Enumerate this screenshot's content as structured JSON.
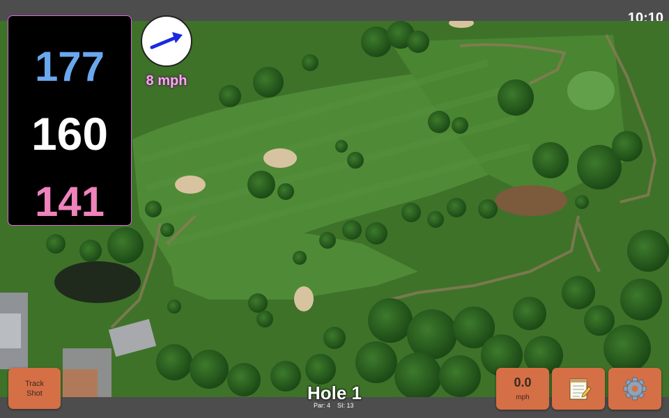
{
  "status": {
    "clock": "10:10"
  },
  "yardages": {
    "back": "177",
    "middle": "160",
    "front": "141"
  },
  "wind": {
    "speed": "8 mph",
    "icon": "wind-arrow-icon",
    "arrow_color": "#1a2adf"
  },
  "buttons": {
    "track_shot": {
      "line1": "Track",
      "line2": "Shot"
    },
    "speed": {
      "value": "0.0",
      "unit": "mph"
    },
    "notes_icon": "notepad-icon",
    "settings_icon": "gear-icon"
  },
  "hole": {
    "title": "Hole 1",
    "par": "Par: 4",
    "si": "SI: 13"
  },
  "colors": {
    "back_yardage": "#6aa8ee",
    "middle_yardage": "#ffffff",
    "front_yardage": "#ef83bb",
    "button_bg": "#d56f45",
    "fairway": "#4f8a34",
    "rough": "#3d7028"
  }
}
